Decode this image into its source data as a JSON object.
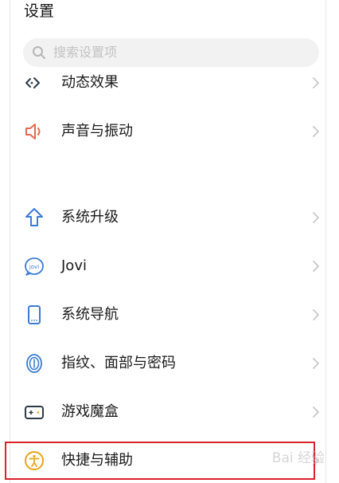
{
  "header": {
    "title": "设置"
  },
  "search": {
    "placeholder": "搜索设置项",
    "icon": "search-icon"
  },
  "settings": {
    "items": [
      {
        "label": "动态效果",
        "icon": "motion-effects-icon",
        "icon_color": "#2d3a4a"
      },
      {
        "label": "声音与振动",
        "icon": "speaker-icon",
        "icon_color": "#e06a4c"
      },
      {
        "label": "系统升级",
        "icon": "upgrade-arrow-icon",
        "icon_color": "#3a7bd5"
      },
      {
        "label": "Jovi",
        "icon": "jovi-icon",
        "icon_color": "#3a7bd5"
      },
      {
        "label": "系统导航",
        "icon": "phone-navigation-icon",
        "icon_color": "#3a7bd5"
      },
      {
        "label": "指纹、面部与密码",
        "icon": "fingerprint-icon",
        "icon_color": "#3a7bd5"
      },
      {
        "label": "游戏魔盒",
        "icon": "game-box-icon",
        "icon_color": "#2d3a4a"
      },
      {
        "label": "快捷与辅助",
        "icon": "accessibility-icon",
        "icon_color": "#e8a317"
      }
    ]
  },
  "annotation": {
    "highlight_color": "#d9242b"
  },
  "watermark": {
    "text": "Bai 经验"
  }
}
